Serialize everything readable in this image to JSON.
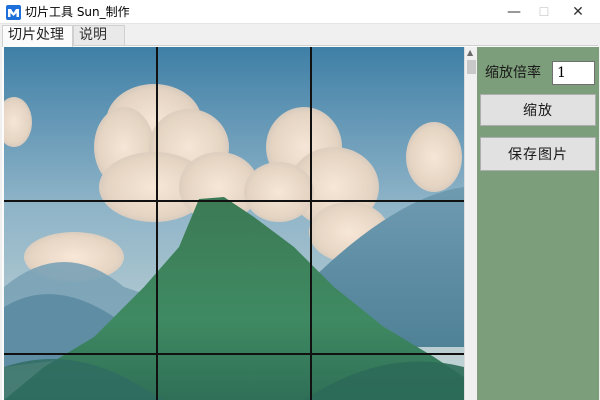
{
  "window": {
    "title": "切片工具  Sun_制作",
    "minimize_glyph": "—",
    "maximize_glyph": "☐",
    "close_glyph": "✕",
    "icon": "app-logo-icon"
  },
  "tabs": [
    {
      "label": "切片处理",
      "active": true
    },
    {
      "label": "说明",
      "active": false
    }
  ],
  "panel": {
    "zoom_label": "缩放倍率",
    "zoom_value": "1",
    "zoom_button": "缩放",
    "save_button": "保存图片",
    "background_color": "#7d9e7a"
  },
  "canvas": {
    "content": "landscape photo with mountain and clouds",
    "grid": "3x3 slice grid lines",
    "grid_color": "#111111"
  },
  "scrollbar": {
    "up_arrow": "▲"
  }
}
